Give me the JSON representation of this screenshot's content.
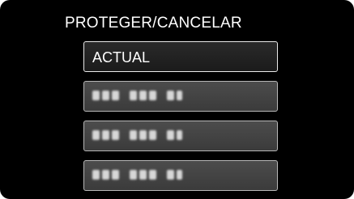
{
  "header": {
    "title": "PROTEGER/CANCELAR"
  },
  "menu": {
    "items": [
      {
        "label": "ACTUAL",
        "selected": true
      },
      {
        "label": "",
        "selected": false,
        "blurred": true
      },
      {
        "label": "",
        "selected": false,
        "blurred": true
      },
      {
        "label": "",
        "selected": false,
        "blurred": true
      }
    ]
  },
  "colors": {
    "background": "#000000",
    "item_fill": "#404040",
    "item_border": "#b7b7b7",
    "selected_border": "#e9e9e9",
    "text": "#ffffff"
  }
}
